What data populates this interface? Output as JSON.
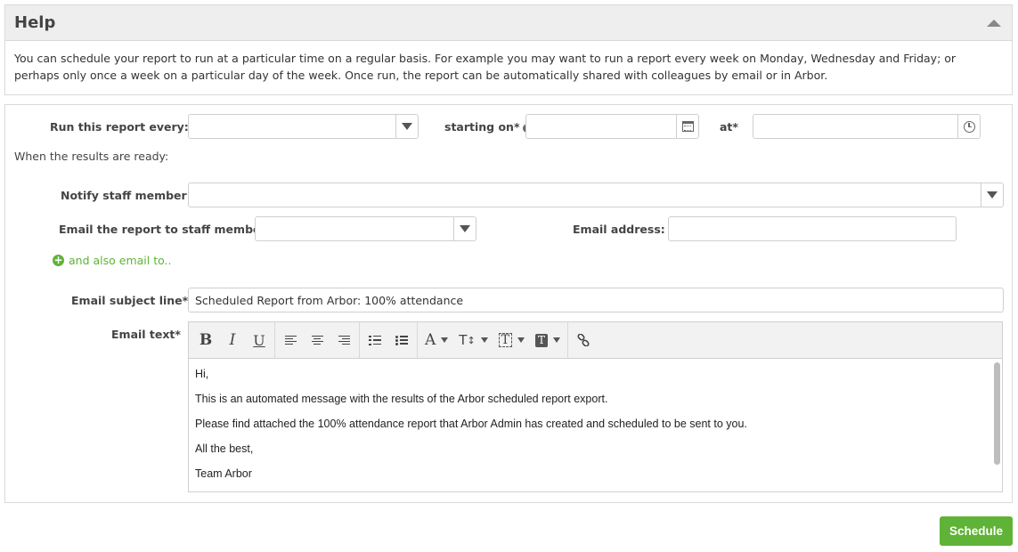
{
  "help": {
    "title": "Help",
    "text": "You can schedule your report to run at a particular time on a regular basis. For example you may want to run a report every week on Monday, Wednesday and Friday; or perhaps only once a week on a particular day of the week. Once run, the report can be automatically shared with colleagues by email or in Arbor."
  },
  "form": {
    "run_every_label": "Run this report every:*",
    "run_every_value": "",
    "starting_on_label": "starting on*",
    "starting_on_value": "",
    "at_label": "at*",
    "at_value": "",
    "results_ready_text": "When the results are ready:",
    "notify_label": "Notify staff member:",
    "notify_value": "",
    "email_report_label": "Email the report to staff member:",
    "email_report_value": "",
    "email_address_label": "Email address:",
    "email_address_value": "",
    "also_email_link": "and also email to..",
    "subject_label": "Email subject line*",
    "subject_value": "Scheduled Report from Arbor: 100% attendance",
    "email_text_label": "Email text*"
  },
  "editor": {
    "toolbar": {
      "bold": "B",
      "italic": "I",
      "underline": "U",
      "font_color": "A",
      "font_size": "T",
      "insert_field": "T",
      "text_style": "T"
    },
    "body": [
      "Hi,",
      "This is an automated message with the results of the Arbor scheduled report export.",
      "Please find attached the 100% attendance report that Arbor Admin has created and scheduled to be sent to you.",
      "All the best,",
      "Team Arbor"
    ]
  },
  "actions": {
    "schedule_label": "Schedule"
  },
  "colors": {
    "accent_green": "#5fb336",
    "panel_header": "#eeeeee",
    "border": "#d9d9d9"
  }
}
